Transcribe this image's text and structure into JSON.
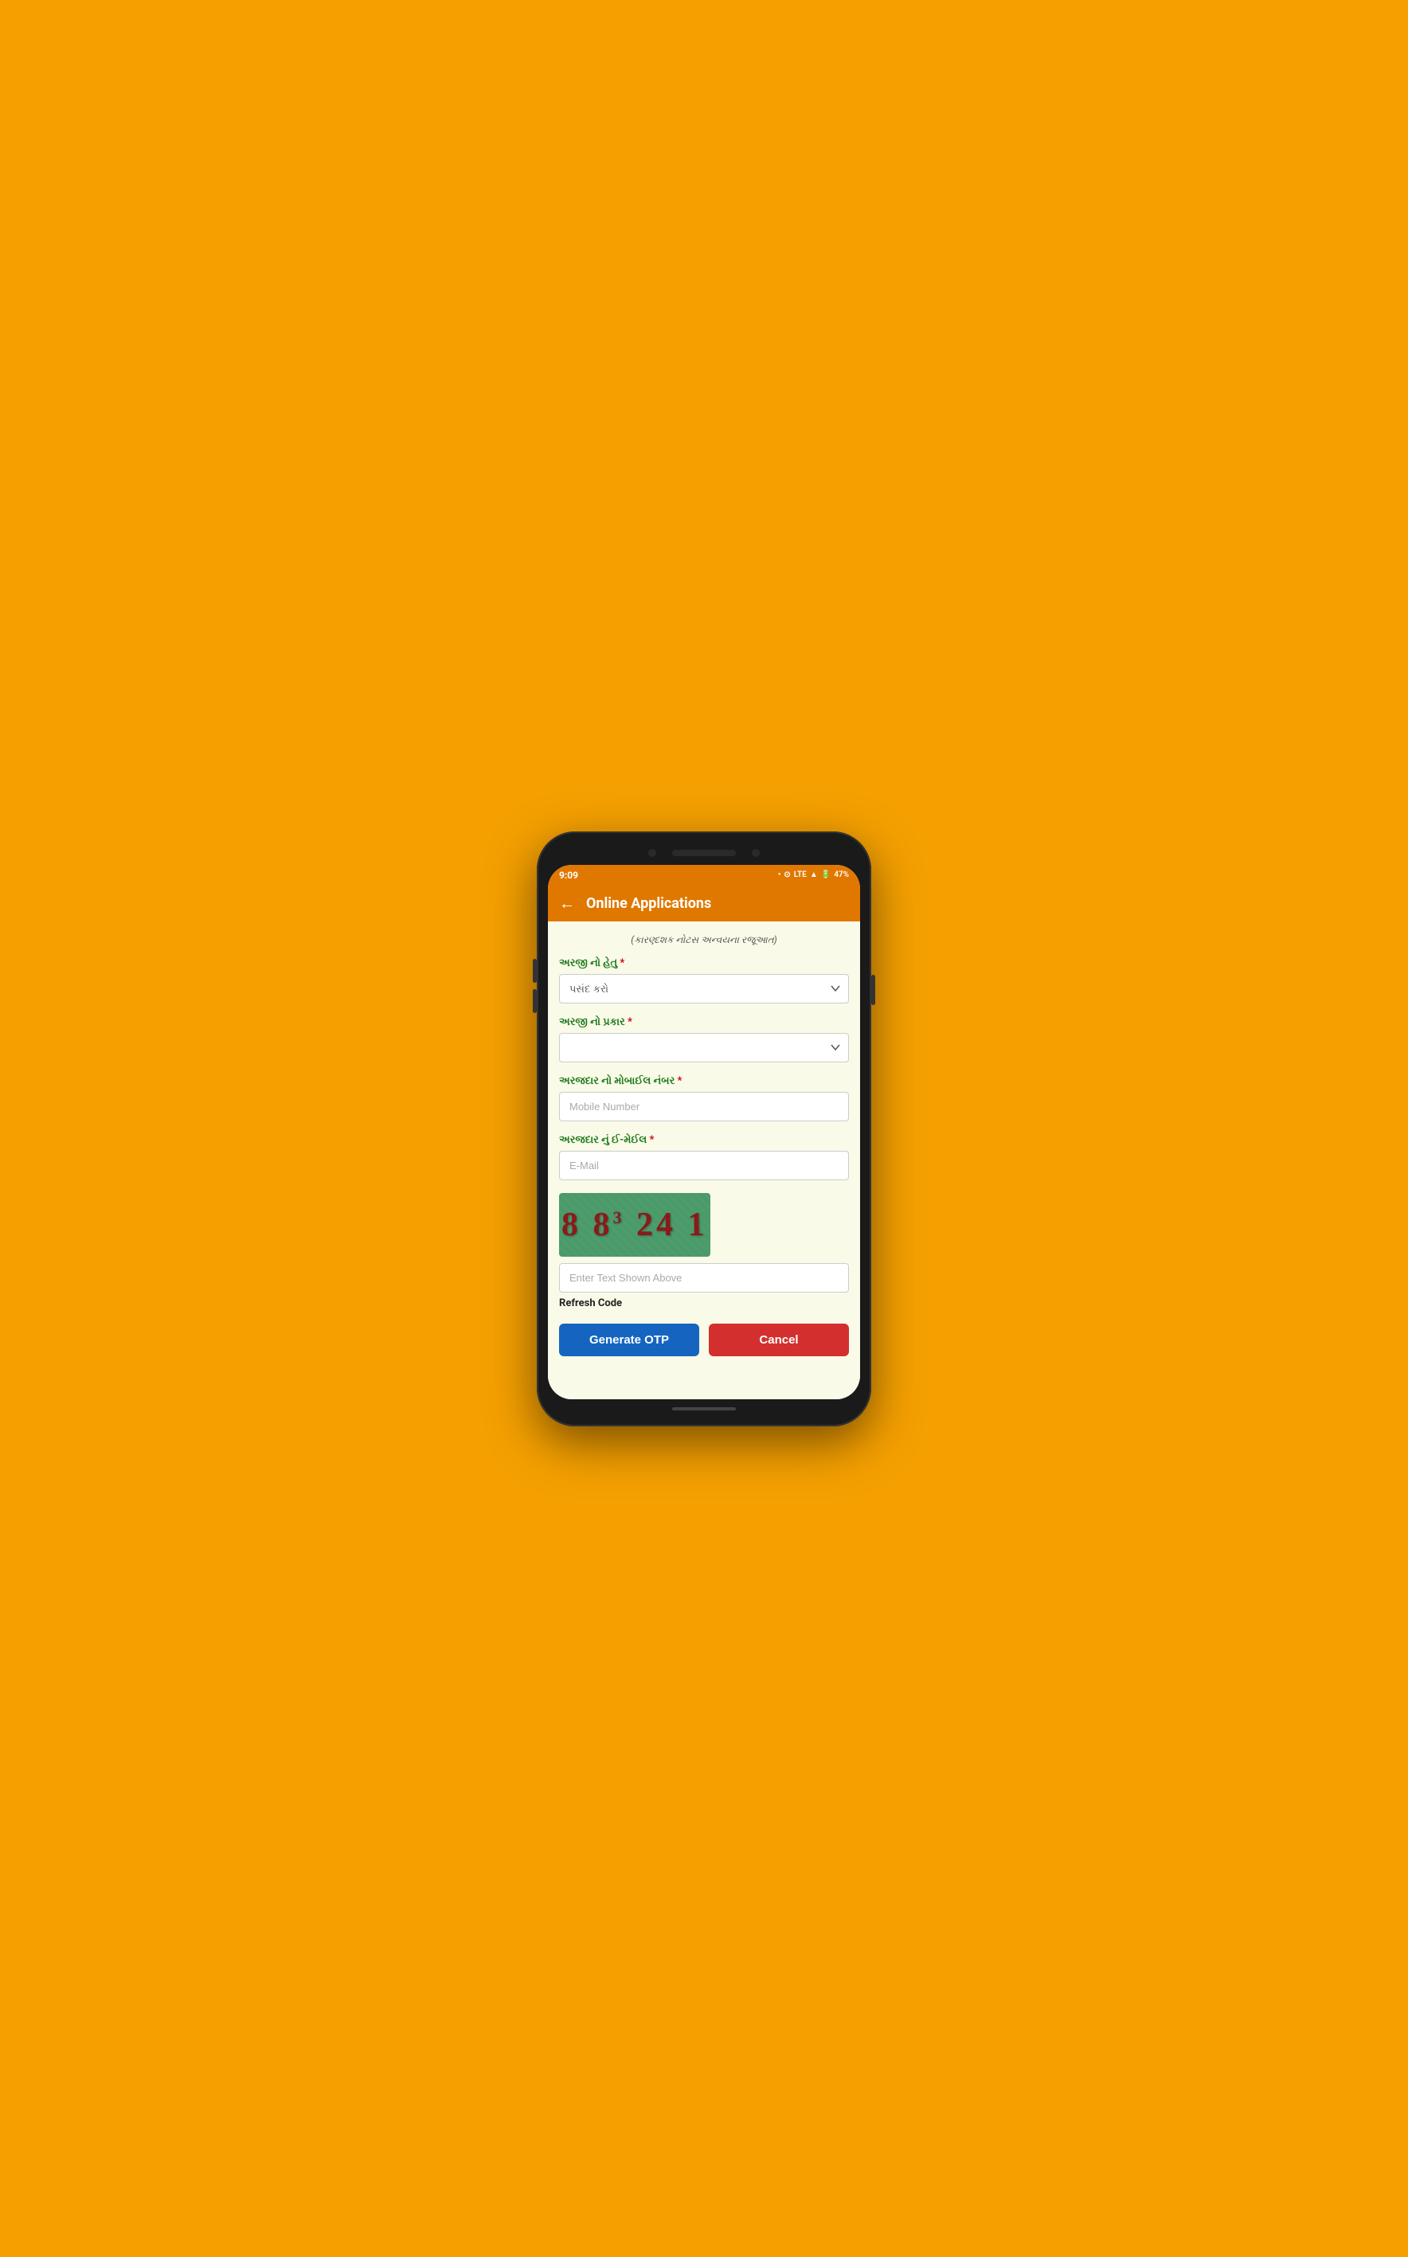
{
  "status_bar": {
    "time": "9:09",
    "battery": "47%",
    "network": "LTE"
  },
  "app_bar": {
    "title": "Online Applications",
    "back_label": "←"
  },
  "form": {
    "breadcrumb": "(કારણ્દશક નોટસ અન્વયના રજૂઆત)",
    "field1": {
      "label": "અરજી નો હેતુ",
      "required": "*",
      "placeholder": "પસંદ કરો",
      "options": [
        "પસંદ કરો"
      ]
    },
    "field2": {
      "label": "અરજી નો પ્રકાર",
      "required": "*",
      "placeholder": "",
      "options": []
    },
    "field3": {
      "label": "અરજદાર નો મોબાઈલ નંબર",
      "required": "*",
      "placeholder": "Mobile Number"
    },
    "field4": {
      "label": "અરજદાર નું ઈ-મેઈલ",
      "required": "*",
      "placeholder": "E-Mail"
    },
    "captcha": {
      "text": "88³241",
      "display": "8 8³ 24 1"
    },
    "captcha_input_placeholder": "Enter Text Shown Above",
    "refresh_code_label": "Refresh Code",
    "btn_otp": "Generate OTP",
    "btn_cancel": "Cancel"
  }
}
